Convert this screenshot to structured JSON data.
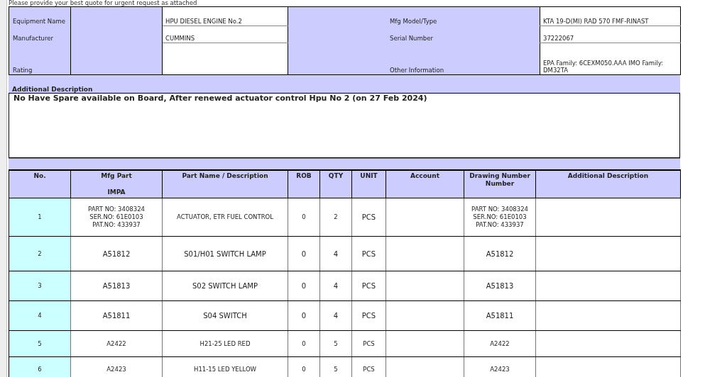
{
  "notice": "Please provide your best quote for urgent request as attached",
  "equipment": {
    "left": [
      {
        "label": "Equipment Name",
        "value": "HPU DIESEL ENGINE No.2"
      },
      {
        "label": "Manufacturer",
        "value": "CUMMINS"
      },
      {
        "label": "Rating"
      }
    ],
    "right": [
      {
        "label": "Mfg Model/Type",
        "value": "KTA 19-D(MI) RAD 570       FMF-RINAST"
      },
      {
        "label": "Serial Number",
        "value": "37222067"
      },
      {
        "label": "Other Information",
        "value": "EPA Family: 6CEXM050.AAA IMO Family: DM32TA"
      }
    ]
  },
  "additional_description": {
    "heading": "Additional Description",
    "text": "No Have Spare available on Board, After renewed actuator control Hpu No 2 (on 27 Feb 2024)"
  },
  "items": {
    "columns": [
      [
        "No."
      ],
      [
        "Mfg Part",
        "IMPA"
      ],
      [
        "Part Name / Description"
      ],
      [
        "ROB"
      ],
      [
        "QTY"
      ],
      [
        "UNIT"
      ],
      [
        "Account"
      ],
      [
        "Drawing Number Number"
      ],
      [
        "Additional Description"
      ]
    ],
    "rows": [
      {
        "no": "1",
        "mfg_part": [
          "PART NO: 3408324",
          "SER.NO: 61E0103",
          "PAT.NO: 433937"
        ],
        "description": "ACTUATOR, ETR FUEL CONTROL",
        "rob": "0",
        "qty": "2",
        "unit": "PCS",
        "drawing_number": [
          "PART NO: 3408324",
          "SER.NO: 61E0103",
          "PAT.NO: 433937"
        ]
      },
      {
        "no": "2",
        "mfg_part": [
          "A51812"
        ],
        "description": "S01/H01 SWITCH LAMP",
        "rob": "0",
        "qty": "4",
        "unit": "PCS",
        "drawing_number": [
          "A51812"
        ]
      },
      {
        "no": "3",
        "mfg_part": [
          "A51813"
        ],
        "description": "S02 SWITCH LAMP",
        "rob": "0",
        "qty": "4",
        "unit": "PCS",
        "drawing_number": [
          "A51813"
        ]
      },
      {
        "no": "4",
        "mfg_part": [
          "A51811"
        ],
        "description": "S04 SWITCH",
        "rob": "0",
        "qty": "4",
        "unit": "PCS",
        "drawing_number": [
          "A51811"
        ]
      },
      {
        "no": "5",
        "mfg_part": [
          "A2422"
        ],
        "description": "H21-25 LED RED",
        "rob": "0",
        "qty": "5",
        "unit": "PCS",
        "drawing_number": [
          "A2422"
        ]
      },
      {
        "no": "6",
        "mfg_part": [
          "A2423"
        ],
        "description": "H11-15 LED YELLOW",
        "rob": "0",
        "qty": "5",
        "unit": "PCS",
        "drawing_number": [
          "A2423"
        ]
      }
    ]
  }
}
